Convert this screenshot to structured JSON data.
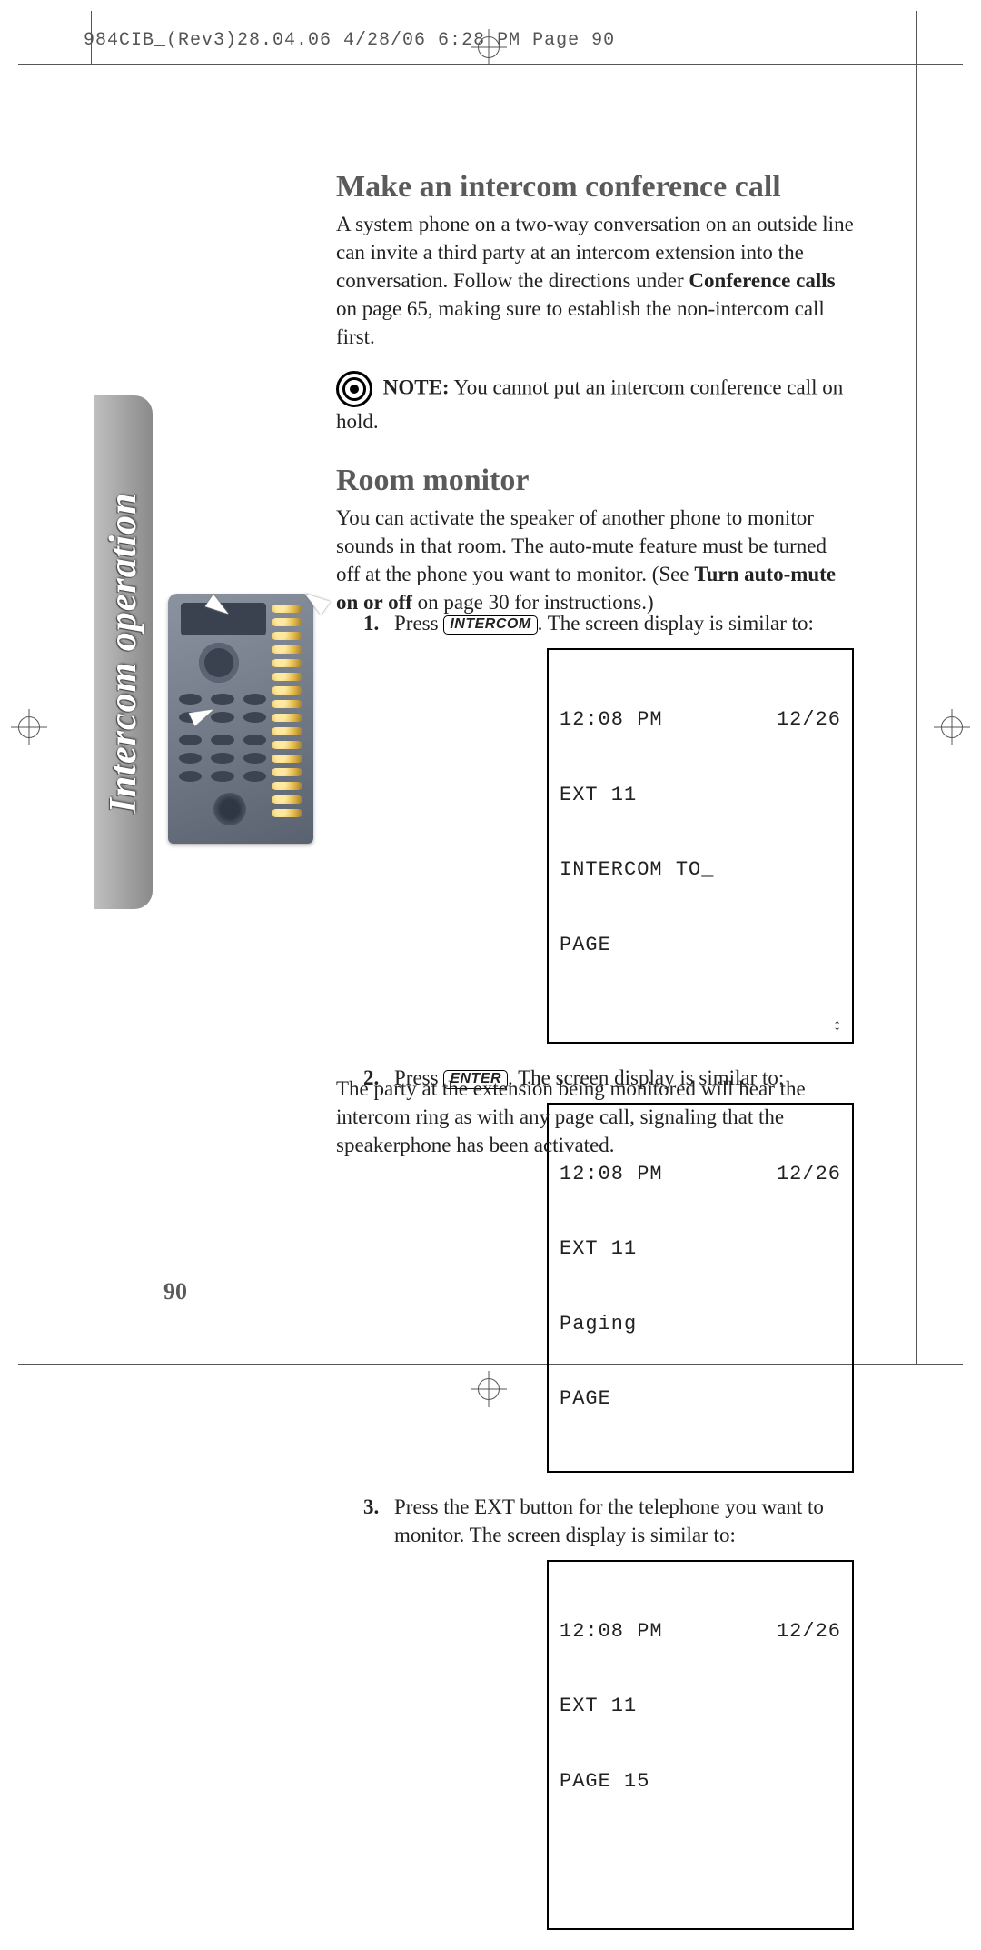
{
  "prepress_header": "984CIB_(Rev3)28.04.06  4/28/06  6:28 PM  Page 90",
  "sidebar_label": "Intercom operation",
  "page_number": "90",
  "h1": "Make an intercom conference call",
  "p1a": "A system phone on a two-way conversation on an outside line can invite a third party at an intercom extension into the conversation.  Follow the directions under ",
  "p1b_bold": "Conference calls",
  "p1c": " on page 65, making sure to establish the non-intercom call first.",
  "note_label": "NOTE:",
  "note_text": "  You cannot put an intercom conference call on hold.",
  "h2": "Room monitor",
  "p2a": "You can activate the speaker of another phone to monitor sounds in that room.  The auto-mute feature must be turned off at the phone you want to monitor. (See ",
  "p2b_bold": "Turn auto-mute on or off",
  "p2c": " on page 30 for instructions.)",
  "steps": {
    "s1": {
      "n": "1.",
      "pre": "Press ",
      "key": "INTERCOM",
      "post": ".  The screen display is similar to:"
    },
    "s2": {
      "n": "2.",
      "pre": "Press ",
      "key": "ENTER",
      "post": ".  The screen display is similar to:"
    },
    "s3": {
      "n": "3.",
      "text": "Press the EXT button for the telephone you want to monitor.  The screen display is similar to:"
    }
  },
  "lcd1": {
    "time": "12:08 PM",
    "date": "12/26",
    "l2": "EXT 11",
    "l3": "INTERCOM TO_",
    "l4": "PAGE",
    "scroll": "↕"
  },
  "lcd2": {
    "time": "12:08 PM",
    "date": "12/26",
    "l2": "EXT 11",
    "l3": "Paging",
    "l4": "PAGE"
  },
  "lcd3": {
    "time": "12:08 PM",
    "date": "12/26",
    "l2": "EXT 11",
    "l3": "PAGE 15",
    "l4": " "
  },
  "closing": "The party at the extension being monitored will hear the intercom ring as with any page call, signaling that the speakerphone has been activated."
}
